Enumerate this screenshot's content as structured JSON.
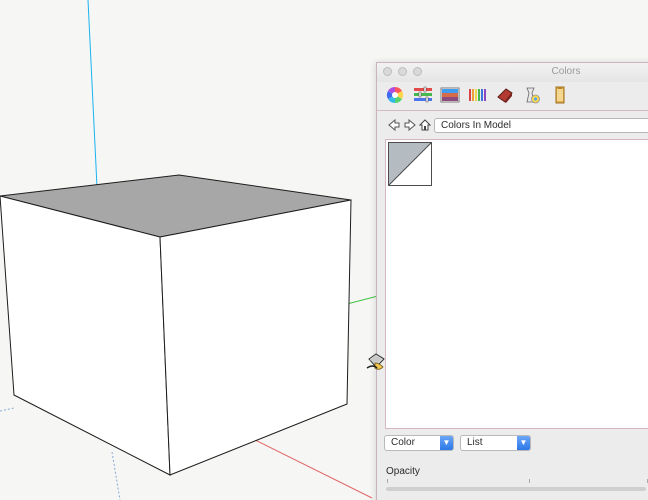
{
  "panel": {
    "title": "Colors",
    "toolbar_icons": [
      "color-wheel-icon",
      "color-sliders-icon",
      "color-palettes-icon",
      "image-palettes-icon",
      "crayons-icon",
      "sketchup-materials-icon",
      "texture-icon"
    ],
    "palette_label": "Colors In Model",
    "swatch_colors": {
      "top_left": "#b4bcc2",
      "bottom_right": "#ffffff"
    },
    "mode_dropdown": "Color",
    "view_dropdown": "List",
    "opacity_label": "Opacity"
  },
  "scene": {
    "cube_top_color": "#a7a7a7",
    "cube_side_color": "#ffffff",
    "axis_blue": "#19b3f1",
    "axis_red": "#e06767",
    "axis_green": "#42c443"
  }
}
